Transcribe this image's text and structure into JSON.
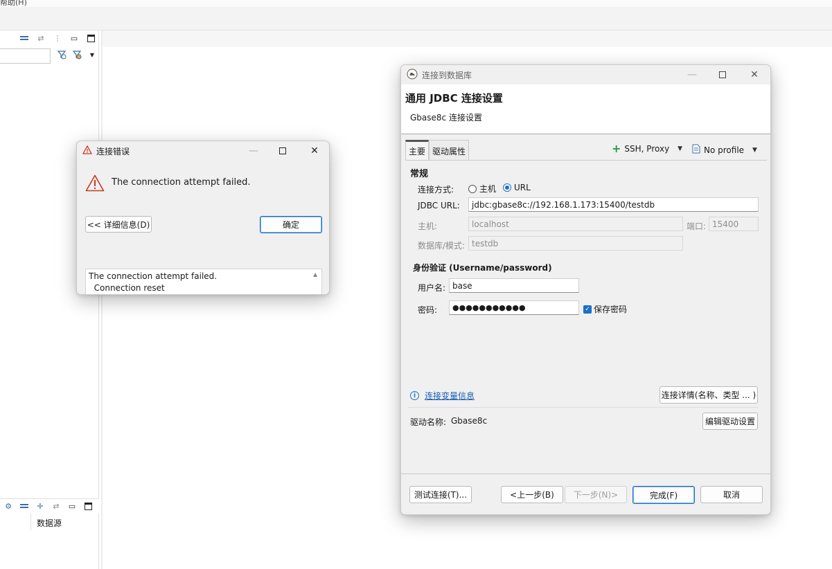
{
  "app": {
    "menu_text": "帮助(H)",
    "navigator_column": "数据源"
  },
  "error_dialog": {
    "title": "连接错误",
    "message": "The connection attempt failed.",
    "details_button": "<< 详细信息(D)",
    "ok_button": "确定",
    "details_text": "The connection attempt failed.\n  Connection reset"
  },
  "connect_dialog": {
    "title": "连接到数据库",
    "header_title": "通用 JDBC 连接设置",
    "header_subtitle": "Gbase8c 连接设置",
    "tabs": [
      "主要",
      "驱动属性"
    ],
    "ssh_proxy": "SSH, Proxy",
    "profile": "No profile",
    "section_general": "常规",
    "connect_mode_label": "连接方式:",
    "mode_host": "主机",
    "mode_url": "URL",
    "selected_mode": "URL",
    "jdbc_url_label": "JDBC URL:",
    "jdbc_url": "jdbc:gbase8c://192.168.1.173:15400/testdb",
    "host_label": "主机:",
    "host_value": "localhost",
    "port_label": "端口:",
    "port_value": "15400",
    "db_label": "数据库/模式:",
    "db_value": "testdb",
    "section_auth": "身份验证 (Username/password)",
    "username_label": "用户名:",
    "username": "base",
    "password_label": "密码:",
    "password_mask": "●●●●●●●●●●●",
    "save_password": "保存密码",
    "save_password_checked": true,
    "variables_link": "连接变量信息",
    "connection_details_button": "连接详情(名称、类型 ... )",
    "driver_name_label": "驱动名称:",
    "driver_name": "Gbase8c",
    "edit_driver_button": "编辑驱动设置",
    "test_button": "测试连接(T)...",
    "back_button": "<上一步(B)",
    "next_button": "下一步(N)>",
    "finish_button": "完成(F)",
    "cancel_button": "取消"
  },
  "colors": {
    "accent": "#1a6fc6",
    "warning": "#c8381e",
    "add_green": "#2e9a3c"
  }
}
